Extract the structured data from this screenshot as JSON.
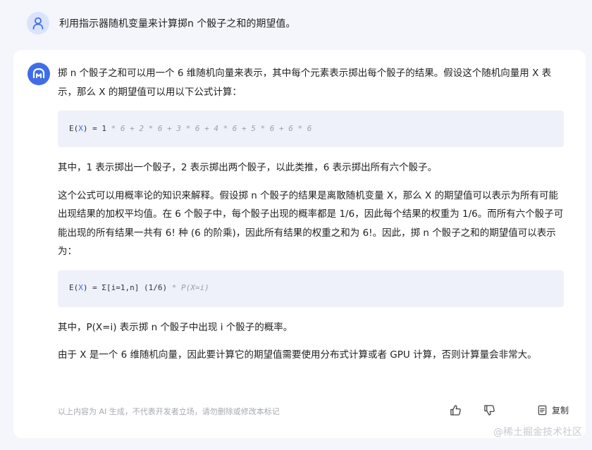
{
  "user": {
    "question": "利用指示器随机变量来计算掷n 个骰子之和的期望值。"
  },
  "answer": {
    "p1": "掷 n 个骰子之和可以用一个 6 维随机向量来表示，其中每个元素表示掷出每个骰子的结果。假设这个随机向量用 X 表示，那么 X 的期望值可以用以下公式计算：",
    "code1": {
      "prefix": "E(",
      "var": "X",
      "mid": ") = 1 ",
      "comment": "* 6 + 2 * 6 + 3 * 6 + 4 * 6 + 5 * 6 + 6 * 6"
    },
    "p2": "其中，1 表示掷出一个骰子，2 表示掷出两个骰子，以此类推，6 表示掷出所有六个骰子。",
    "p3": "这个公式可以用概率论的知识来解释。假设掷 n 个骰子的结果是离散随机变量 X，那么 X 的期望值可以表示为所有可能出现结果的加权平均值。在 6 个骰子中，每个骰子出现的概率都是 1/6，因此每个结果的权重为 1/6。而所有六个骰子可能出现的所有结果一共有 6! 种 (6 的阶乘)，因此所有结果的权重之和为 6!。因此，掷 n 个骰子之和的期望值可以表示为：",
    "code2": {
      "prefix": "E(",
      "var": "X",
      "mid": ") = Σ[i=1,n] (1/6) ",
      "comment": "* P(X=i)"
    },
    "p4": "其中，P(X=i) 表示掷 n 个骰子中出现 i 个骰子的概率。",
    "p5": "由于 X 是一个 6 维随机向量，因此要计算它的期望值需要使用分布式计算或者 GPU 计算，否则计算量会非常大。"
  },
  "footer": {
    "disclaimer": "以上内容为 AI 生成，不代表开发者立场，请勿删除或修改本标记",
    "copy_label": "复制",
    "like_icon": "thumbs-up-icon",
    "dislike_icon": "thumbs-down-icon",
    "copy_icon": "copy-icon"
  },
  "watermark": "@稀土掘金技术社区",
  "colors": {
    "accent": "#3f6de8",
    "page_bg": "#f4f6fb",
    "code_bg": "#eef1fa"
  }
}
